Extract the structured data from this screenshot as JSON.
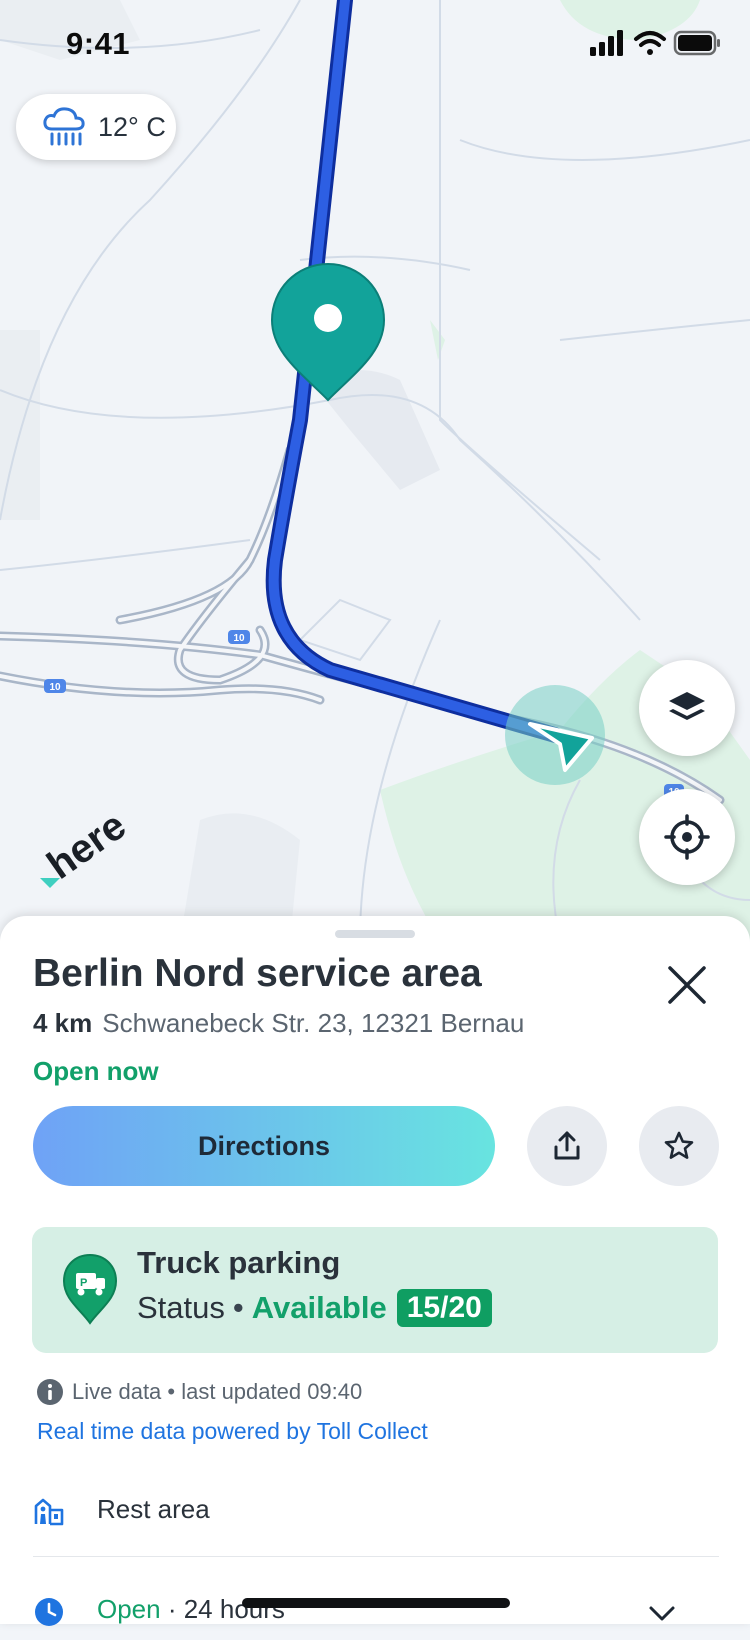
{
  "status_bar": {
    "time": "9:41",
    "icons": [
      "signal-icon",
      "wifi-icon",
      "battery-icon"
    ]
  },
  "weather": {
    "icon": "rain-cloud-icon",
    "temperature": "12° C"
  },
  "map": {
    "road_labels": [
      "10",
      "10",
      "10"
    ],
    "branding": "here",
    "colors": {
      "route": "#1f4fd6",
      "route_outline": "#0e2e9e",
      "marker": "#12a39a",
      "park": "#def2e6"
    }
  },
  "map_controls": {
    "layers_icon": "layers-icon",
    "locate_icon": "crosshair-icon"
  },
  "poi": {
    "title": "Berlin Nord service area",
    "distance": "4 km",
    "address": "Schwanebeck Str. 23, 12321 Bernau",
    "open_status": "Open now"
  },
  "actions": {
    "directions_label": "Directions",
    "share_icon": "share-icon",
    "favorite_icon": "star-icon"
  },
  "truck_parking": {
    "title": "Truck parking",
    "status_label": "Status",
    "separator": "•",
    "availability": "Available",
    "count": "15/20"
  },
  "live_data": {
    "text": "Live data • last updated 09:40",
    "source_link": "Real time data powered by Toll Collect"
  },
  "details": {
    "rest_area": "Rest area",
    "hours_open": "Open",
    "hours_value": " · 24 hours"
  }
}
